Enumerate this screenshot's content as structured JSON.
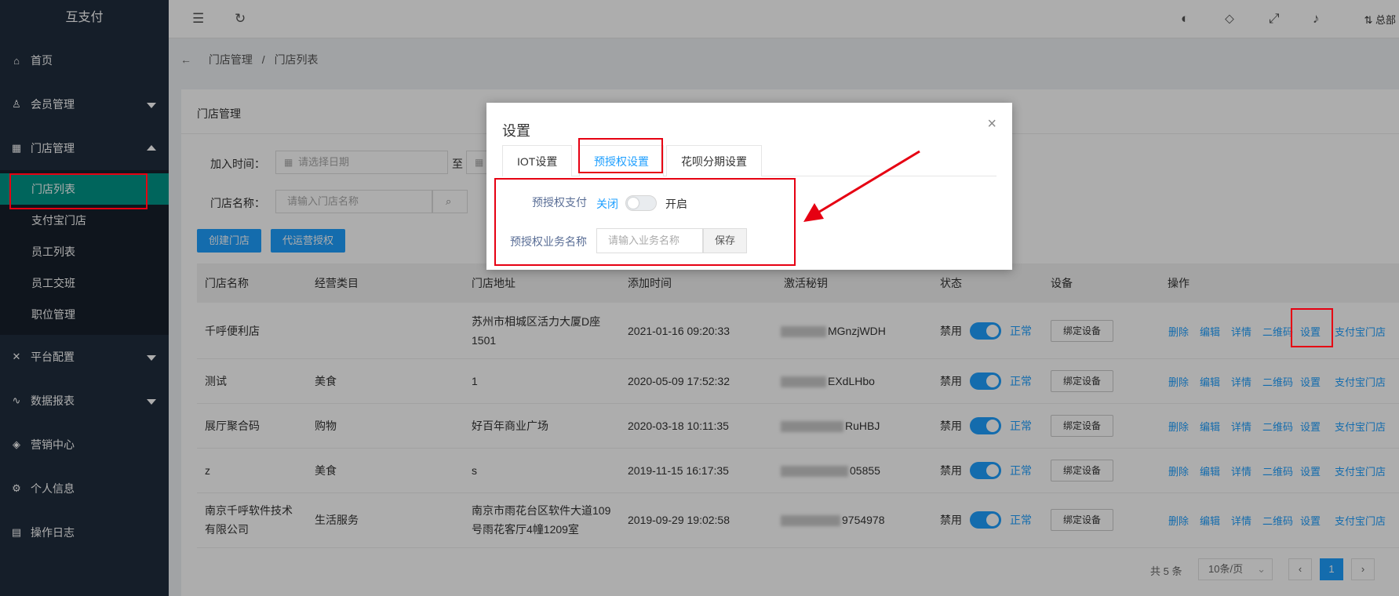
{
  "sidebar": {
    "logo": "互支付",
    "items": [
      {
        "label": "首页",
        "icon": "home-icon"
      },
      {
        "label": "会员管理",
        "icon": "user-icon"
      },
      {
        "label": "门店管理",
        "icon": "grid-icon"
      },
      {
        "label": "平台配置",
        "icon": "tools-icon"
      },
      {
        "label": "数据报表",
        "icon": "chart-icon"
      },
      {
        "label": "营销中心",
        "icon": "cube-icon"
      },
      {
        "label": "个人信息",
        "icon": "gear-icon"
      },
      {
        "label": "操作日志",
        "icon": "doc-icon"
      }
    ],
    "submenu": [
      "门店列表",
      "支付宝门店",
      "员工列表",
      "员工交班",
      "职位管理"
    ]
  },
  "header": {
    "user": "总部"
  },
  "breadcrumb": {
    "parent": "门店管理",
    "sep": "/",
    "current": "门店列表"
  },
  "card_title": "门店管理",
  "filters": {
    "join_time_label": "加入时间：",
    "date_placeholder": "请选择日期",
    "to_label": "至",
    "store_name_label": "门店名称：",
    "store_name_placeholder": "请输入门店名称"
  },
  "buttons": {
    "create": "创建门店",
    "agent_auth": "代运营授权"
  },
  "table": {
    "headers": [
      "门店名称",
      "经营类目",
      "门店地址",
      "添加时间",
      "激活秘钥",
      "状态",
      "设备",
      "操作"
    ],
    "rows": [
      {
        "name": "千呼便利店",
        "category": "",
        "address": "苏州市相城区活力大厦D座1501",
        "time": "2021-01-16 09:20:33",
        "key": "MGnzjWDH"
      },
      {
        "name": "测试",
        "category": "美食",
        "address": "1",
        "time": "2020-05-09 17:52:32",
        "key": "EXdLHbo"
      },
      {
        "name": "展厅聚合码",
        "category": "购物",
        "address": "好百年商业广场",
        "time": "2020-03-18 10:11:35",
        "key": "RuHBJ"
      },
      {
        "name": "z",
        "category": "美食",
        "address": "s",
        "time": "2019-11-15 16:17:35",
        "key": "05855"
      },
      {
        "name": "南京千呼软件技术有限公司",
        "category": "生活服务",
        "address": "南京市雨花台区软件大道109号雨花客厅4幢1209室",
        "time": "2019-09-29 19:02:58",
        "key": "9754978"
      }
    ],
    "status_off": "禁用",
    "status_on": "正常",
    "bind_label": "绑定设备",
    "ops": [
      "删除",
      "编辑",
      "详情",
      "二维码",
      "设置",
      "支付宝门店"
    ]
  },
  "pagination": {
    "total": "共 5 条",
    "page_size": "10条/页",
    "current": "1",
    "prev": "‹",
    "next": "›"
  },
  "modal": {
    "title": "设置",
    "tabs": [
      "IOT设置",
      "预授权设置",
      "花呗分期设置"
    ],
    "preauth_label": "预授权支付",
    "off_label": "关闭",
    "on_label": "开启",
    "biz_name_label": "预授权业务名称",
    "biz_name_placeholder": "请输入业务名称",
    "save_label": "保存"
  },
  "colors": {
    "sidebar": "#1f2d3d",
    "active": "#009688",
    "link": "#1e9fff",
    "annotation": "#e60012"
  }
}
